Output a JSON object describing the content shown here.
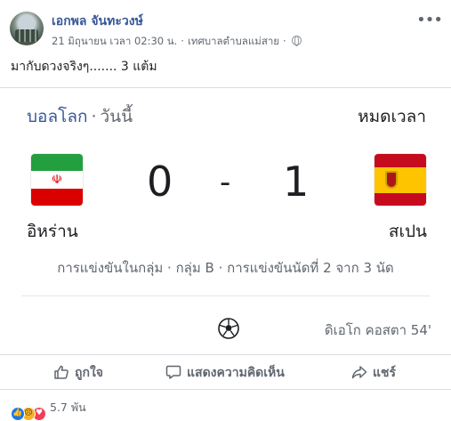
{
  "post": {
    "author": "เอกพล จันทะวงษ์",
    "timestamp": "21 มิถุนายน เวลา 02:30 น.",
    "location": "เทศบาลตำบลแม่สาย",
    "privacy_icon": "globe-icon",
    "text": "มากับดวงจริงๆ....... 3 แต้ม"
  },
  "match": {
    "competition": "บอลโลก",
    "day": "วันนี้",
    "status": "หมดเวลา",
    "home_team": "อิหร่าน",
    "away_team": "สเปน",
    "home_score": "0",
    "score_separator": "-",
    "away_score": "1",
    "stage": "การแข่งขันในกลุ่ม · กลุ่ม B · การแข่งขันนัดที่ 2 จาก 3 นัด",
    "goal_scorer": "ดิเอโก คอสตา 54'",
    "colors": {
      "iran_green": "#239f40",
      "iran_red": "#da0000",
      "spain_red": "#c60b1e",
      "spain_yellow": "#ffc400"
    }
  },
  "actions": {
    "like_label": "ถูกใจ",
    "comment_label": "แสดงความคิดเห็น",
    "share_label": "แชร์"
  },
  "reactions": {
    "count": "5.7 พัน",
    "types": [
      "like",
      "sad",
      "love"
    ]
  },
  "colors": {
    "link_blue": "#385898",
    "secondary_text": "#606770"
  }
}
